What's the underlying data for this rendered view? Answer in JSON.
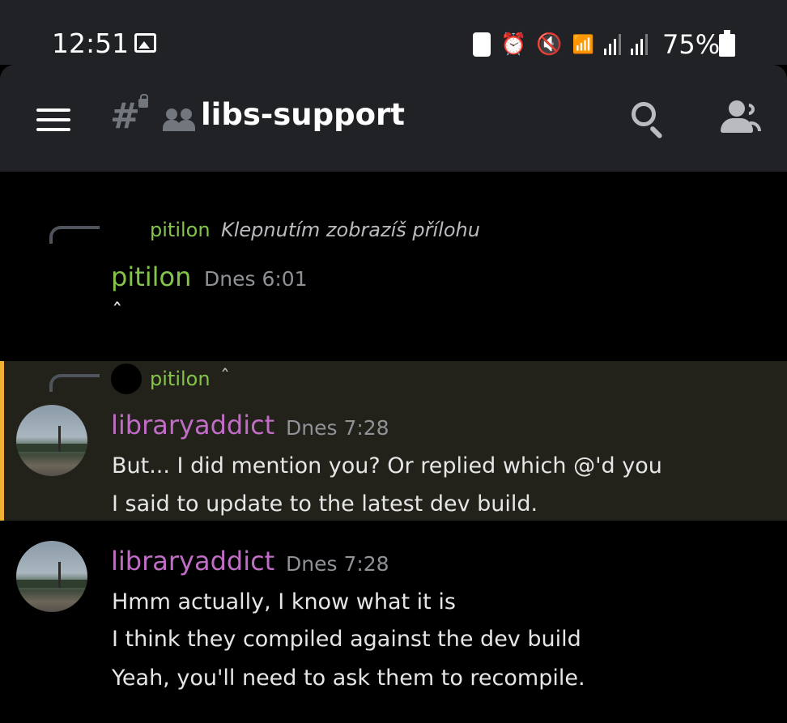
{
  "status_bar": {
    "time": "12:51",
    "battery_percent": "75%"
  },
  "header": {
    "channel_name": "libs-support"
  },
  "messages": [
    {
      "reply": {
        "user": "pitilon",
        "text": "Klepnutím zobrazíš přílohu"
      },
      "author": "pitilon",
      "timestamp": "Dnes 6:01",
      "lines": [
        "ˆ"
      ]
    },
    {
      "reply": {
        "user": "pitilon",
        "text": "ˆ"
      },
      "author": "libraryaddict",
      "timestamp": "Dnes 7:28",
      "lines": [
        "But... I did mention you? Or replied which @'d you",
        "I said to update to the latest dev build."
      ],
      "highlighted": true
    },
    {
      "author": "libraryaddict",
      "timestamp": "Dnes 7:28",
      "lines": [
        "Hmm actually, I know what it is",
        "I think they compiled against the dev build",
        "Yeah, you'll need to ask them to recompile."
      ]
    }
  ],
  "colors": {
    "header_bg": "#202225",
    "background": "#000000",
    "mention_highlight": "#f0b132",
    "author_green": "#84c44a",
    "author_pink": "#c06ec5"
  }
}
